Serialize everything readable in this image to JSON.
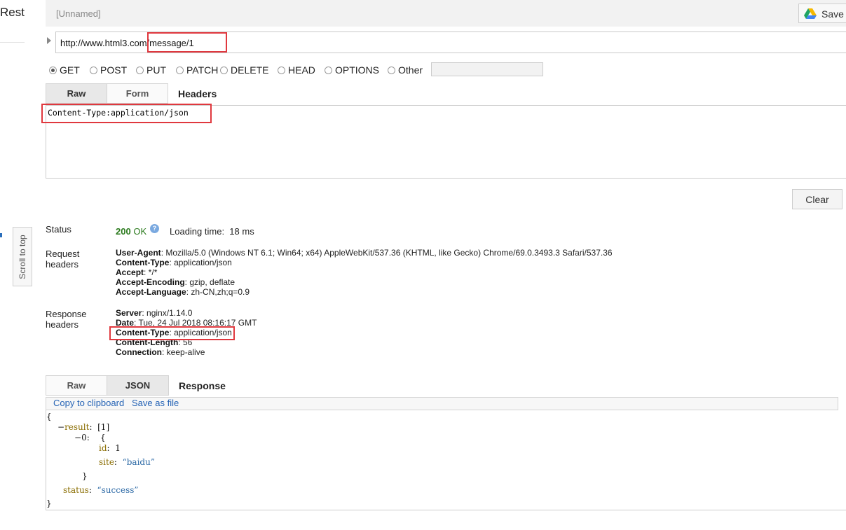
{
  "app": {
    "name": "Rest",
    "scroll_to_top": "Scroll to top"
  },
  "toolbar": {
    "request_name": "[Unnamed]",
    "save_label": "Save"
  },
  "url": {
    "value": "http://www.html3.com/message/1"
  },
  "methods": [
    {
      "label": "GET",
      "selected": true
    },
    {
      "label": "POST",
      "selected": false
    },
    {
      "label": "PUT",
      "selected": false
    },
    {
      "label": "PATCH",
      "selected": false
    },
    {
      "label": "DELETE",
      "selected": false
    },
    {
      "label": "HEAD",
      "selected": false
    },
    {
      "label": "OPTIONS",
      "selected": false
    },
    {
      "label": "Other",
      "selected": false
    }
  ],
  "request_tabs": {
    "raw": "Raw",
    "form": "Form",
    "title": "Headers"
  },
  "request_headers_text": "Content-Type:application/json",
  "clear_label": "Clear",
  "status": {
    "label": "Status",
    "code": "200",
    "text": "OK",
    "loading_label": "Loading time:",
    "loading_value": "18 ms"
  },
  "request_headers": {
    "label_line1": "Request",
    "label_line2": "headers",
    "items": [
      {
        "name": "User-Agent",
        "value": ": Mozilla/5.0 (Windows NT 6.1; Win64; x64) AppleWebKit/537.36 (KHTML, like Gecko) Chrome/69.0.3493.3 Safari/537.36"
      },
      {
        "name": "Content-Type",
        "value": ": application/json"
      },
      {
        "name": "Accept",
        "value": ": */*"
      },
      {
        "name": "Accept-Encoding",
        "value": ": gzip, deflate"
      },
      {
        "name": "Accept-Language",
        "value": ": zh-CN,zh;q=0.9"
      }
    ]
  },
  "response_headers": {
    "label_line1": "Response",
    "label_line2": "headers",
    "items": [
      {
        "name": "Server",
        "value": ": nginx/1.14.0"
      },
      {
        "name": "Date",
        "value": ": Tue, 24 Jul 2018 08:16:17 GMT"
      },
      {
        "name": "Content-Type",
        "value": ": application/json"
      },
      {
        "name": "Content-Length",
        "value": ": 56"
      },
      {
        "name": "Connection",
        "value": ": keep-alive"
      }
    ]
  },
  "response_tabs": {
    "raw": "Raw",
    "json": "JSON",
    "title": "Response"
  },
  "response_actions": {
    "copy": "Copy to clipboard",
    "save": "Save as file"
  },
  "response_json": {
    "open": "{",
    "result_toggle": "−",
    "result_key": "result",
    "result_count": "[1]",
    "item_toggle": "−",
    "item_key": "0:",
    "item_open": "{",
    "id_key": "id",
    "id_value": "1",
    "site_key": "site",
    "site_value": "“baidu”",
    "item_close": "}",
    "status_key": "status",
    "status_value": "“success”",
    "close": "}"
  },
  "colors": {
    "highlight": "#e0383e",
    "status_ok": "#2b7a1d",
    "link": "#2563b5"
  }
}
